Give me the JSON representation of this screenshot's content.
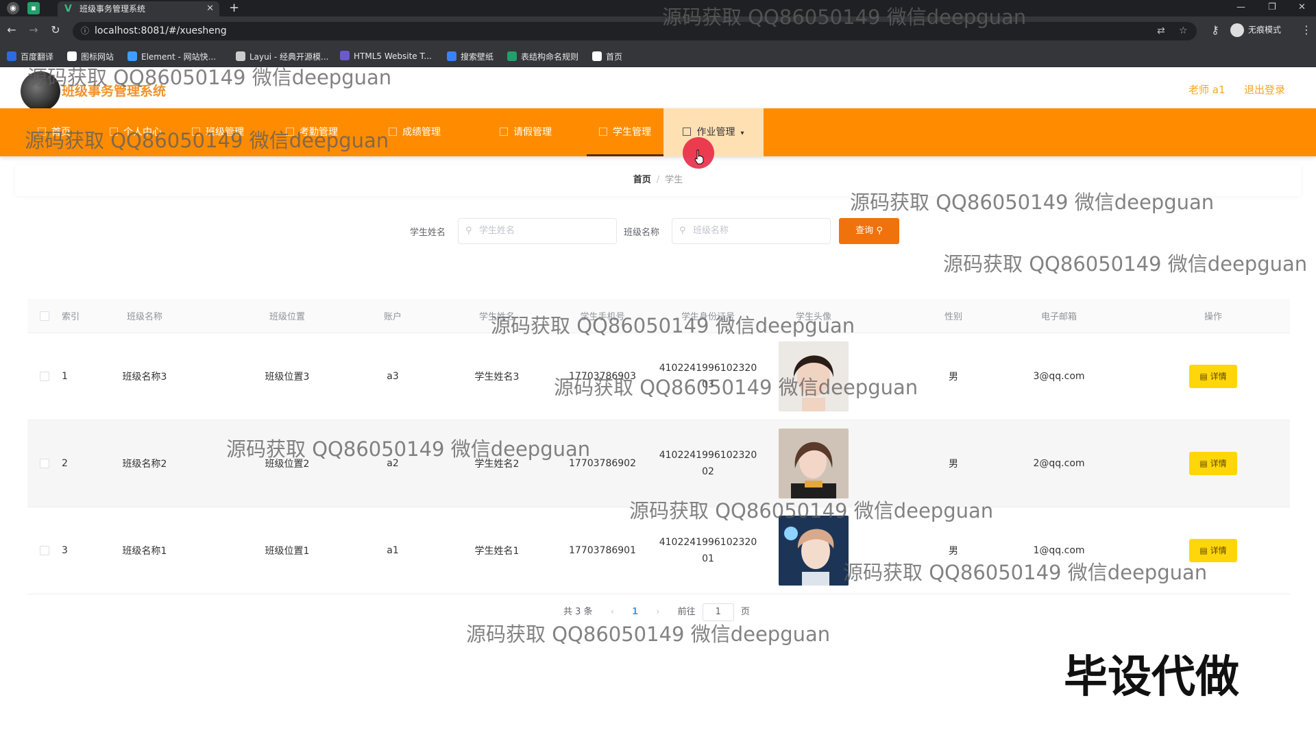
{
  "browser": {
    "tab_title": "班级事务管理系统",
    "url": "localhost:8081/#/xuesheng",
    "incognito_label": "无痕模式",
    "bookmarks": [
      {
        "label": "百度翻译",
        "color": "#2d6cdf"
      },
      {
        "label": "图标网站",
        "color": "#ffffff"
      },
      {
        "label": "Element - 网站快...",
        "color": "#409eff"
      },
      {
        "label": "Layui - 经典开源模...",
        "color": "#cccccc"
      },
      {
        "label": "HTML5 Website T...",
        "color": "#6a5acd"
      },
      {
        "label": "搜索壁纸",
        "color": "#3b82f6"
      },
      {
        "label": "表结构命名规则",
        "color": "#22a06b"
      },
      {
        "label": "首页",
        "color": "#ffffff"
      }
    ]
  },
  "app": {
    "title": "班级事务管理系统",
    "user_label": "老师 a1",
    "logout_label": "退出登录",
    "accent": "#ff8c00"
  },
  "nav": {
    "items": [
      "首页",
      "个人中心",
      "班级管理",
      "考勤管理",
      "成绩管理",
      "请假管理",
      "学生管理",
      "作业管理"
    ]
  },
  "breadcrumb": {
    "home": "首页",
    "separator": "/",
    "current": "学生"
  },
  "search": {
    "name_label": "学生姓名",
    "name_placeholder": "学生姓名",
    "class_label": "班级名称",
    "class_placeholder": "班级名称",
    "button_label": "查询"
  },
  "table": {
    "headers": [
      "索引",
      "班级名称",
      "班级位置",
      "账户",
      "学生姓名",
      "学生手机号",
      "学生身份证号",
      "学生头像",
      "性别",
      "电子邮箱",
      "操作"
    ],
    "rows": [
      {
        "index": "1",
        "class_name": "班级名称3",
        "class_location": "班级位置3",
        "account": "a3",
        "student_name": "学生姓名3",
        "phone": "17703786903",
        "id_card": "410224199610232003",
        "gender": "男",
        "email": "3@qq.com",
        "action": "详情"
      },
      {
        "index": "2",
        "class_name": "班级名称2",
        "class_location": "班级位置2",
        "account": "a2",
        "student_name": "学生姓名2",
        "phone": "17703786902",
        "id_card": "410224199610232002",
        "gender": "男",
        "email": "2@qq.com",
        "action": "详情"
      },
      {
        "index": "3",
        "class_name": "班级名称1",
        "class_location": "班级位置1",
        "account": "a1",
        "student_name": "学生姓名1",
        "phone": "17703786901",
        "id_card": "410224199610232001",
        "gender": "男",
        "email": "1@qq.com",
        "action": "详情"
      }
    ]
  },
  "pagination": {
    "total": "共 3 条",
    "current_page": "1",
    "goto_label": "前往",
    "goto_value": "1",
    "page_suffix": "页"
  },
  "overlays": {
    "watermark": "源码获取 QQ86050149 微信deepguan",
    "stamp": "毕设代做"
  }
}
